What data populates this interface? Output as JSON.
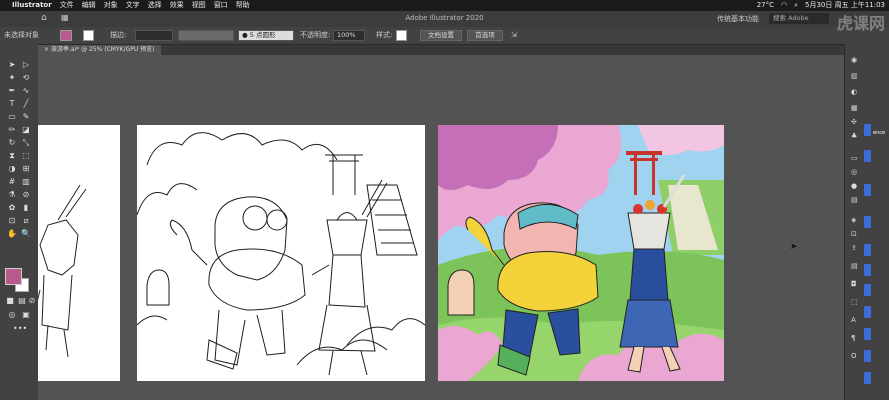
{
  "menubar": {
    "apple": "",
    "app": "Illustrator",
    "items": [
      "文件",
      "编辑",
      "对象",
      "文字",
      "选择",
      "效果",
      "视图",
      "窗口",
      "帮助"
    ],
    "status": {
      "temp": "27°C",
      "datetime": "5月30日 周五 上午11:03"
    }
  },
  "titlebar": {
    "title": "Adobe Illustrator 2020",
    "workspace": "传统基本功能",
    "search_placeholder": "搜索 Adobe"
  },
  "control_bar": {
    "selection": "未选择对象",
    "stroke_label": "描边:",
    "brush": "5 点圆形",
    "opacity_label": "不透明度:",
    "opacity_value": "100%",
    "style_label": "样式:",
    "doc_setup": "文档设置",
    "prefs": "首选项"
  },
  "document": {
    "tab_label": "旅游季.ai* @ 25% (CMYK/GPU 预览)",
    "close_glyph": "×"
  },
  "panel": {
    "label": "ence"
  },
  "watermark": "虎课网",
  "colors": {
    "fill": "#b85a8b",
    "stroke": "#ffffff",
    "accent": "#3d6bd8"
  }
}
